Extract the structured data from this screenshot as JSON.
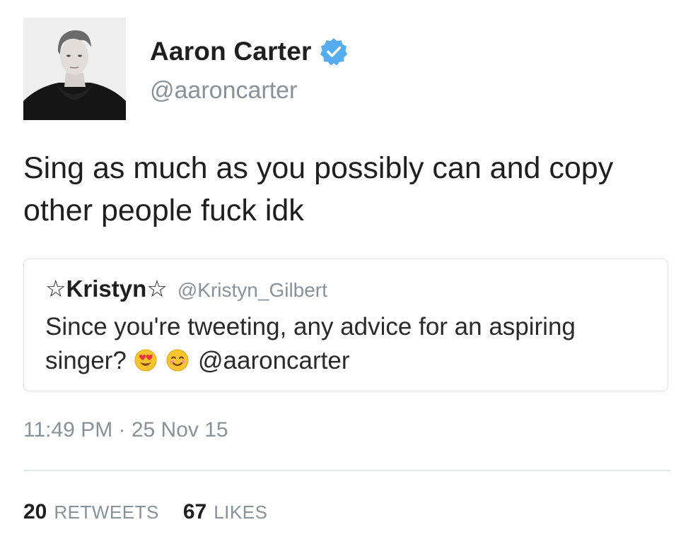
{
  "author": {
    "display_name": "Aaron Carter",
    "handle": "@aaroncarter",
    "verified": true,
    "verified_color": "#55acee"
  },
  "tweet": {
    "text_line1": "Sing as much as you possibly can and copy",
    "text_line2": "other people fuck idk",
    "timestamp": "11:49 PM · 25 Nov 15"
  },
  "quoted_tweet": {
    "display_name": "☆Kristyn☆",
    "handle": "@Kristyn_Gilbert",
    "text_line1": "Since you're tweeting, any advice for an aspiring",
    "text_line2_prefix": "singer?",
    "emojis": [
      "heart-eyes-emoji-icon",
      "smiling-emoji-icon"
    ],
    "mention": "@aaroncarter"
  },
  "stats": {
    "retweets_count": "20",
    "retweets_label": "RETWEETS",
    "likes_count": "67",
    "likes_label": "LIKES"
  },
  "colors": {
    "text_primary": "#1f1f1f",
    "text_secondary": "#8a9299",
    "divider": "#e4e7ea"
  }
}
